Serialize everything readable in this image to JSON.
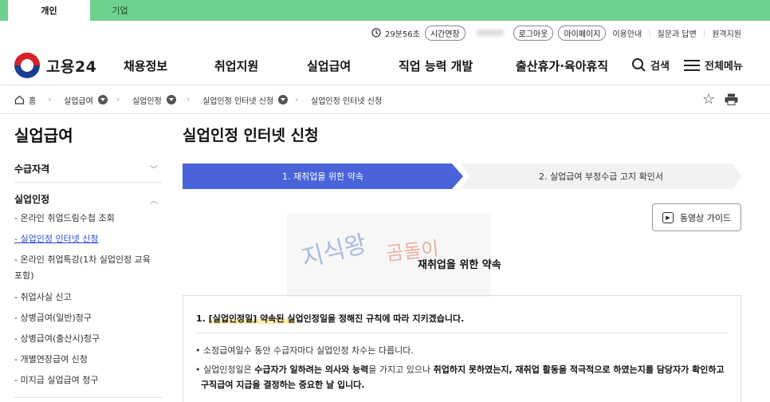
{
  "top_tabs": [
    {
      "label": "개인"
    },
    {
      "label": "기업"
    }
  ],
  "util": {
    "timer": "29분56초",
    "extend": "시간연장",
    "logout": "로그아웃",
    "mypage": "마이페이지",
    "guide": "이용안내",
    "qna": "질문과 답변",
    "remote": "원격지원"
  },
  "header": {
    "logo": "고용24",
    "nav": [
      "채용정보",
      "취업지원",
      "실업급여",
      "직업 능력 개발",
      "출산휴가·육아휴직"
    ],
    "search": "검색",
    "all_menu": "전체메뉴"
  },
  "breadcrumb": [
    "홈",
    "실업급여",
    "실업인정",
    "실업인정 인터넷 신청",
    "실업인정 인터넷 신청"
  ],
  "sidebar": {
    "title": "실업급여",
    "sections": [
      {
        "label": "수급자격",
        "arrow": "﹀"
      },
      {
        "label": "실업인정",
        "arrow": "︿"
      }
    ],
    "items": [
      "- 온라인 취업드림수첩 조회",
      "- 실업인정 인터넷 신청",
      "- 온라인 취업특강(1차 실업인정 교육 포함)",
      "- 취업사실 신고",
      "- 상병급여(일반)청구",
      "- 상병급여(출산시)청구",
      "- 개별연장급여 신청",
      "- 미지급 실업급여 청구"
    ]
  },
  "main": {
    "title": "실업인정 인터넷 신청",
    "steps": [
      "1. 재취업을 위한 약속",
      "2. 실업급여 부정수급 고지 확인서"
    ],
    "video_button": "동영상 가이드",
    "watermark": [
      "지식왕",
      "곰돌이"
    ],
    "section_title": "재취업을 위한 약속",
    "box": {
      "heading_num": "1. ",
      "heading_hl": "[실업인정일] 약속된 실",
      "heading_rest": "업인정일을 정해진 규칙에 따라 지키겠습니다.",
      "bullet1": "소정급여일수 동안 수급자마다 실업인정 차수는 다릅니다.",
      "bullet2_a": "실업인정일은 ",
      "bullet2_b": "수급자가 일하려는 의사와 능력",
      "bullet2_c": "을 가지고 있으나 ",
      "bullet2_d": "취업하지 못하였는지, 재취업 활동을 적극적으로 하였는지를 담당자가 확인하고",
      "bullet2_e": "구직급여 지급을 결정하는 중요한 날 입니다."
    }
  }
}
